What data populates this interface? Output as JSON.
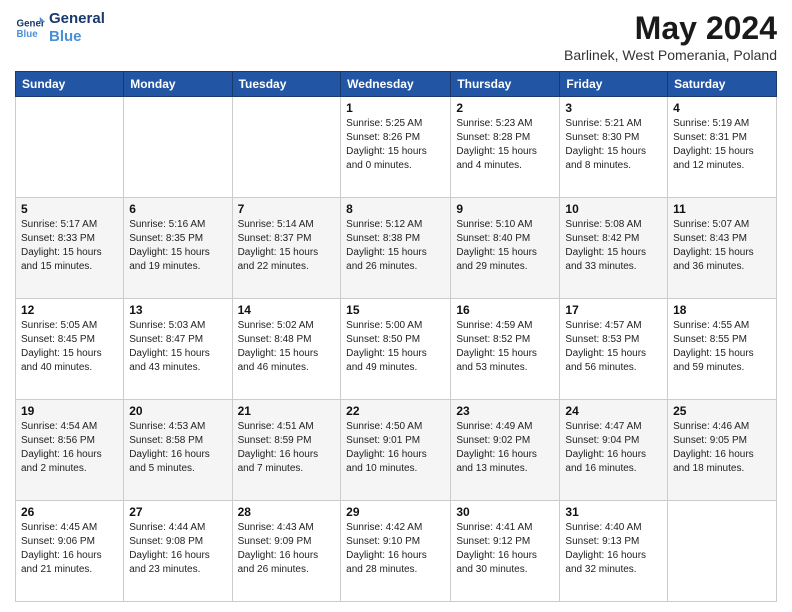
{
  "logo": {
    "line1": "General",
    "line2": "Blue"
  },
  "title": "May 2024",
  "subtitle": "Barlinek, West Pomerania, Poland",
  "weekdays": [
    "Sunday",
    "Monday",
    "Tuesday",
    "Wednesday",
    "Thursday",
    "Friday",
    "Saturday"
  ],
  "weeks": [
    [
      {
        "day": "",
        "info": ""
      },
      {
        "day": "",
        "info": ""
      },
      {
        "day": "",
        "info": ""
      },
      {
        "day": "1",
        "info": "Sunrise: 5:25 AM\nSunset: 8:26 PM\nDaylight: 15 hours\nand 0 minutes."
      },
      {
        "day": "2",
        "info": "Sunrise: 5:23 AM\nSunset: 8:28 PM\nDaylight: 15 hours\nand 4 minutes."
      },
      {
        "day": "3",
        "info": "Sunrise: 5:21 AM\nSunset: 8:30 PM\nDaylight: 15 hours\nand 8 minutes."
      },
      {
        "day": "4",
        "info": "Sunrise: 5:19 AM\nSunset: 8:31 PM\nDaylight: 15 hours\nand 12 minutes."
      }
    ],
    [
      {
        "day": "5",
        "info": "Sunrise: 5:17 AM\nSunset: 8:33 PM\nDaylight: 15 hours\nand 15 minutes."
      },
      {
        "day": "6",
        "info": "Sunrise: 5:16 AM\nSunset: 8:35 PM\nDaylight: 15 hours\nand 19 minutes."
      },
      {
        "day": "7",
        "info": "Sunrise: 5:14 AM\nSunset: 8:37 PM\nDaylight: 15 hours\nand 22 minutes."
      },
      {
        "day": "8",
        "info": "Sunrise: 5:12 AM\nSunset: 8:38 PM\nDaylight: 15 hours\nand 26 minutes."
      },
      {
        "day": "9",
        "info": "Sunrise: 5:10 AM\nSunset: 8:40 PM\nDaylight: 15 hours\nand 29 minutes."
      },
      {
        "day": "10",
        "info": "Sunrise: 5:08 AM\nSunset: 8:42 PM\nDaylight: 15 hours\nand 33 minutes."
      },
      {
        "day": "11",
        "info": "Sunrise: 5:07 AM\nSunset: 8:43 PM\nDaylight: 15 hours\nand 36 minutes."
      }
    ],
    [
      {
        "day": "12",
        "info": "Sunrise: 5:05 AM\nSunset: 8:45 PM\nDaylight: 15 hours\nand 40 minutes."
      },
      {
        "day": "13",
        "info": "Sunrise: 5:03 AM\nSunset: 8:47 PM\nDaylight: 15 hours\nand 43 minutes."
      },
      {
        "day": "14",
        "info": "Sunrise: 5:02 AM\nSunset: 8:48 PM\nDaylight: 15 hours\nand 46 minutes."
      },
      {
        "day": "15",
        "info": "Sunrise: 5:00 AM\nSunset: 8:50 PM\nDaylight: 15 hours\nand 49 minutes."
      },
      {
        "day": "16",
        "info": "Sunrise: 4:59 AM\nSunset: 8:52 PM\nDaylight: 15 hours\nand 53 minutes."
      },
      {
        "day": "17",
        "info": "Sunrise: 4:57 AM\nSunset: 8:53 PM\nDaylight: 15 hours\nand 56 minutes."
      },
      {
        "day": "18",
        "info": "Sunrise: 4:55 AM\nSunset: 8:55 PM\nDaylight: 15 hours\nand 59 minutes."
      }
    ],
    [
      {
        "day": "19",
        "info": "Sunrise: 4:54 AM\nSunset: 8:56 PM\nDaylight: 16 hours\nand 2 minutes."
      },
      {
        "day": "20",
        "info": "Sunrise: 4:53 AM\nSunset: 8:58 PM\nDaylight: 16 hours\nand 5 minutes."
      },
      {
        "day": "21",
        "info": "Sunrise: 4:51 AM\nSunset: 8:59 PM\nDaylight: 16 hours\nand 7 minutes."
      },
      {
        "day": "22",
        "info": "Sunrise: 4:50 AM\nSunset: 9:01 PM\nDaylight: 16 hours\nand 10 minutes."
      },
      {
        "day": "23",
        "info": "Sunrise: 4:49 AM\nSunset: 9:02 PM\nDaylight: 16 hours\nand 13 minutes."
      },
      {
        "day": "24",
        "info": "Sunrise: 4:47 AM\nSunset: 9:04 PM\nDaylight: 16 hours\nand 16 minutes."
      },
      {
        "day": "25",
        "info": "Sunrise: 4:46 AM\nSunset: 9:05 PM\nDaylight: 16 hours\nand 18 minutes."
      }
    ],
    [
      {
        "day": "26",
        "info": "Sunrise: 4:45 AM\nSunset: 9:06 PM\nDaylight: 16 hours\nand 21 minutes."
      },
      {
        "day": "27",
        "info": "Sunrise: 4:44 AM\nSunset: 9:08 PM\nDaylight: 16 hours\nand 23 minutes."
      },
      {
        "day": "28",
        "info": "Sunrise: 4:43 AM\nSunset: 9:09 PM\nDaylight: 16 hours\nand 26 minutes."
      },
      {
        "day": "29",
        "info": "Sunrise: 4:42 AM\nSunset: 9:10 PM\nDaylight: 16 hours\nand 28 minutes."
      },
      {
        "day": "30",
        "info": "Sunrise: 4:41 AM\nSunset: 9:12 PM\nDaylight: 16 hours\nand 30 minutes."
      },
      {
        "day": "31",
        "info": "Sunrise: 4:40 AM\nSunset: 9:13 PM\nDaylight: 16 hours\nand 32 minutes."
      },
      {
        "day": "",
        "info": ""
      }
    ]
  ]
}
